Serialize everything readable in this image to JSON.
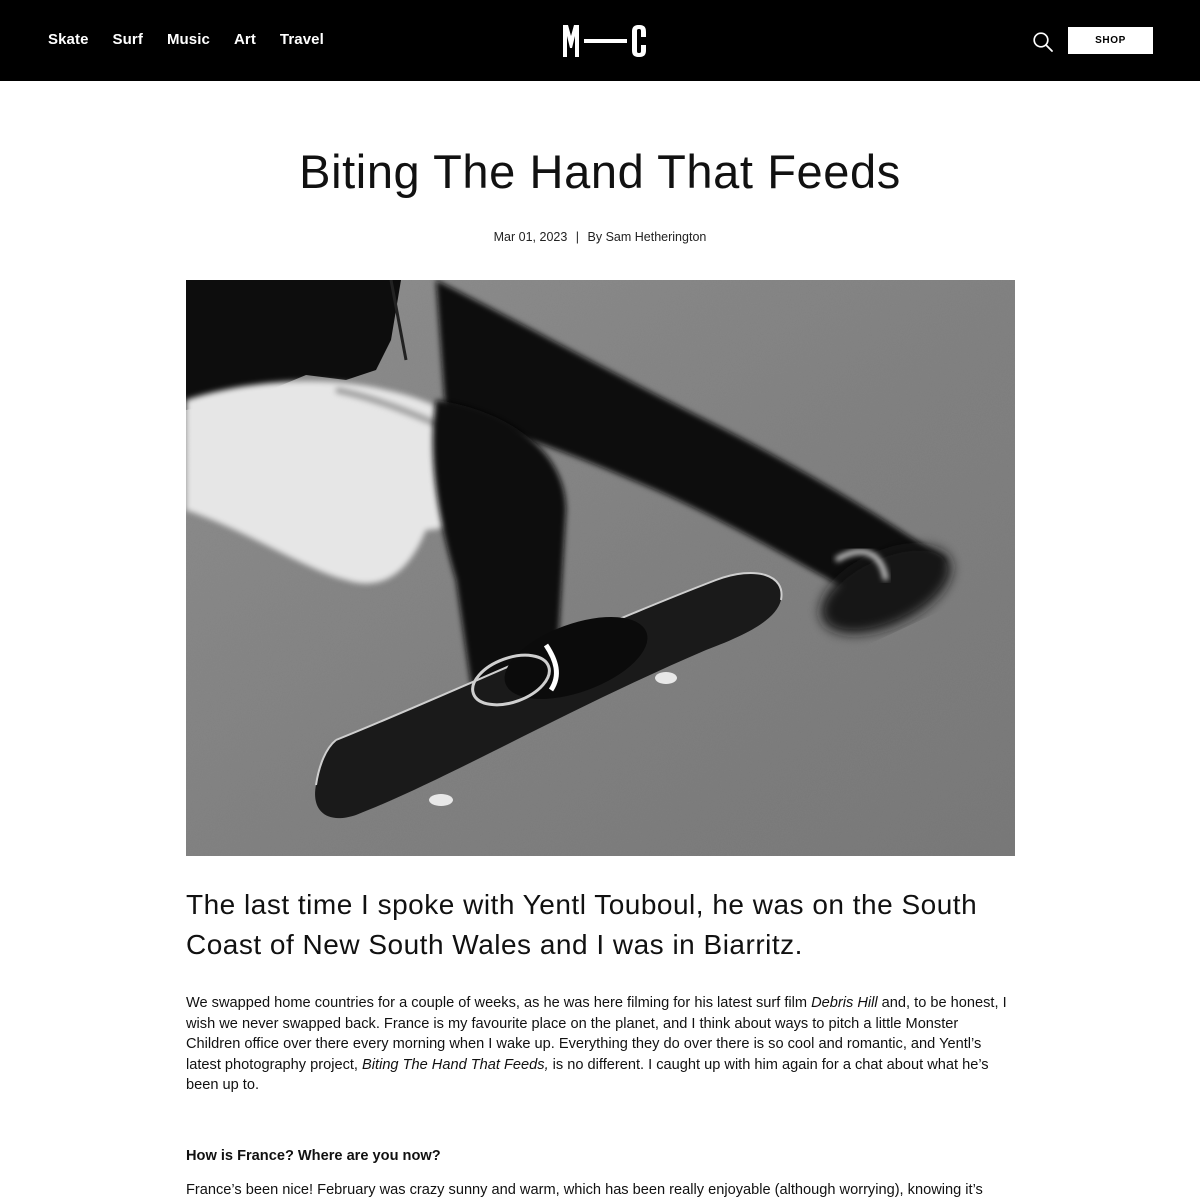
{
  "header": {
    "nav": [
      "Skate",
      "Surf",
      "Music",
      "Art",
      "Travel"
    ],
    "logo_text": "M—C",
    "search_icon": "search-icon",
    "shop_label": "SHOP"
  },
  "article": {
    "title": "Biting The Hand That Feeds",
    "date": "Mar 01, 2023",
    "separator": "|",
    "byline": "By Sam Hetherington",
    "hero_image_alt": "skateboard",
    "lede": "The last time I spoke with Yentl Touboul, he was on the South Coast of New South Wales and I was in Biarritz.",
    "intro": {
      "p1": "We swapped home countries for a couple of weeks, as he was here filming for his latest surf film ",
      "film": "Debris Hill",
      "p2": " and, to be honest, I wish we never swapped back. France is my favourite place on the planet, and I think about ways to pitch a little Monster Children office over there every morning when I wake up. Everything they do over there is so cool and romantic, and Yentl’s latest photography project, ",
      "project": "Biting The Hand That Feeds,",
      "p3": " is no different. I caught up with him again for a chat about what he’s been up to."
    },
    "question_1": "How is France? Where are you now?",
    "answer_1": "France’s been nice! February was crazy sunny and warm, which has been really enjoyable (although worrying), knowing it’s"
  }
}
